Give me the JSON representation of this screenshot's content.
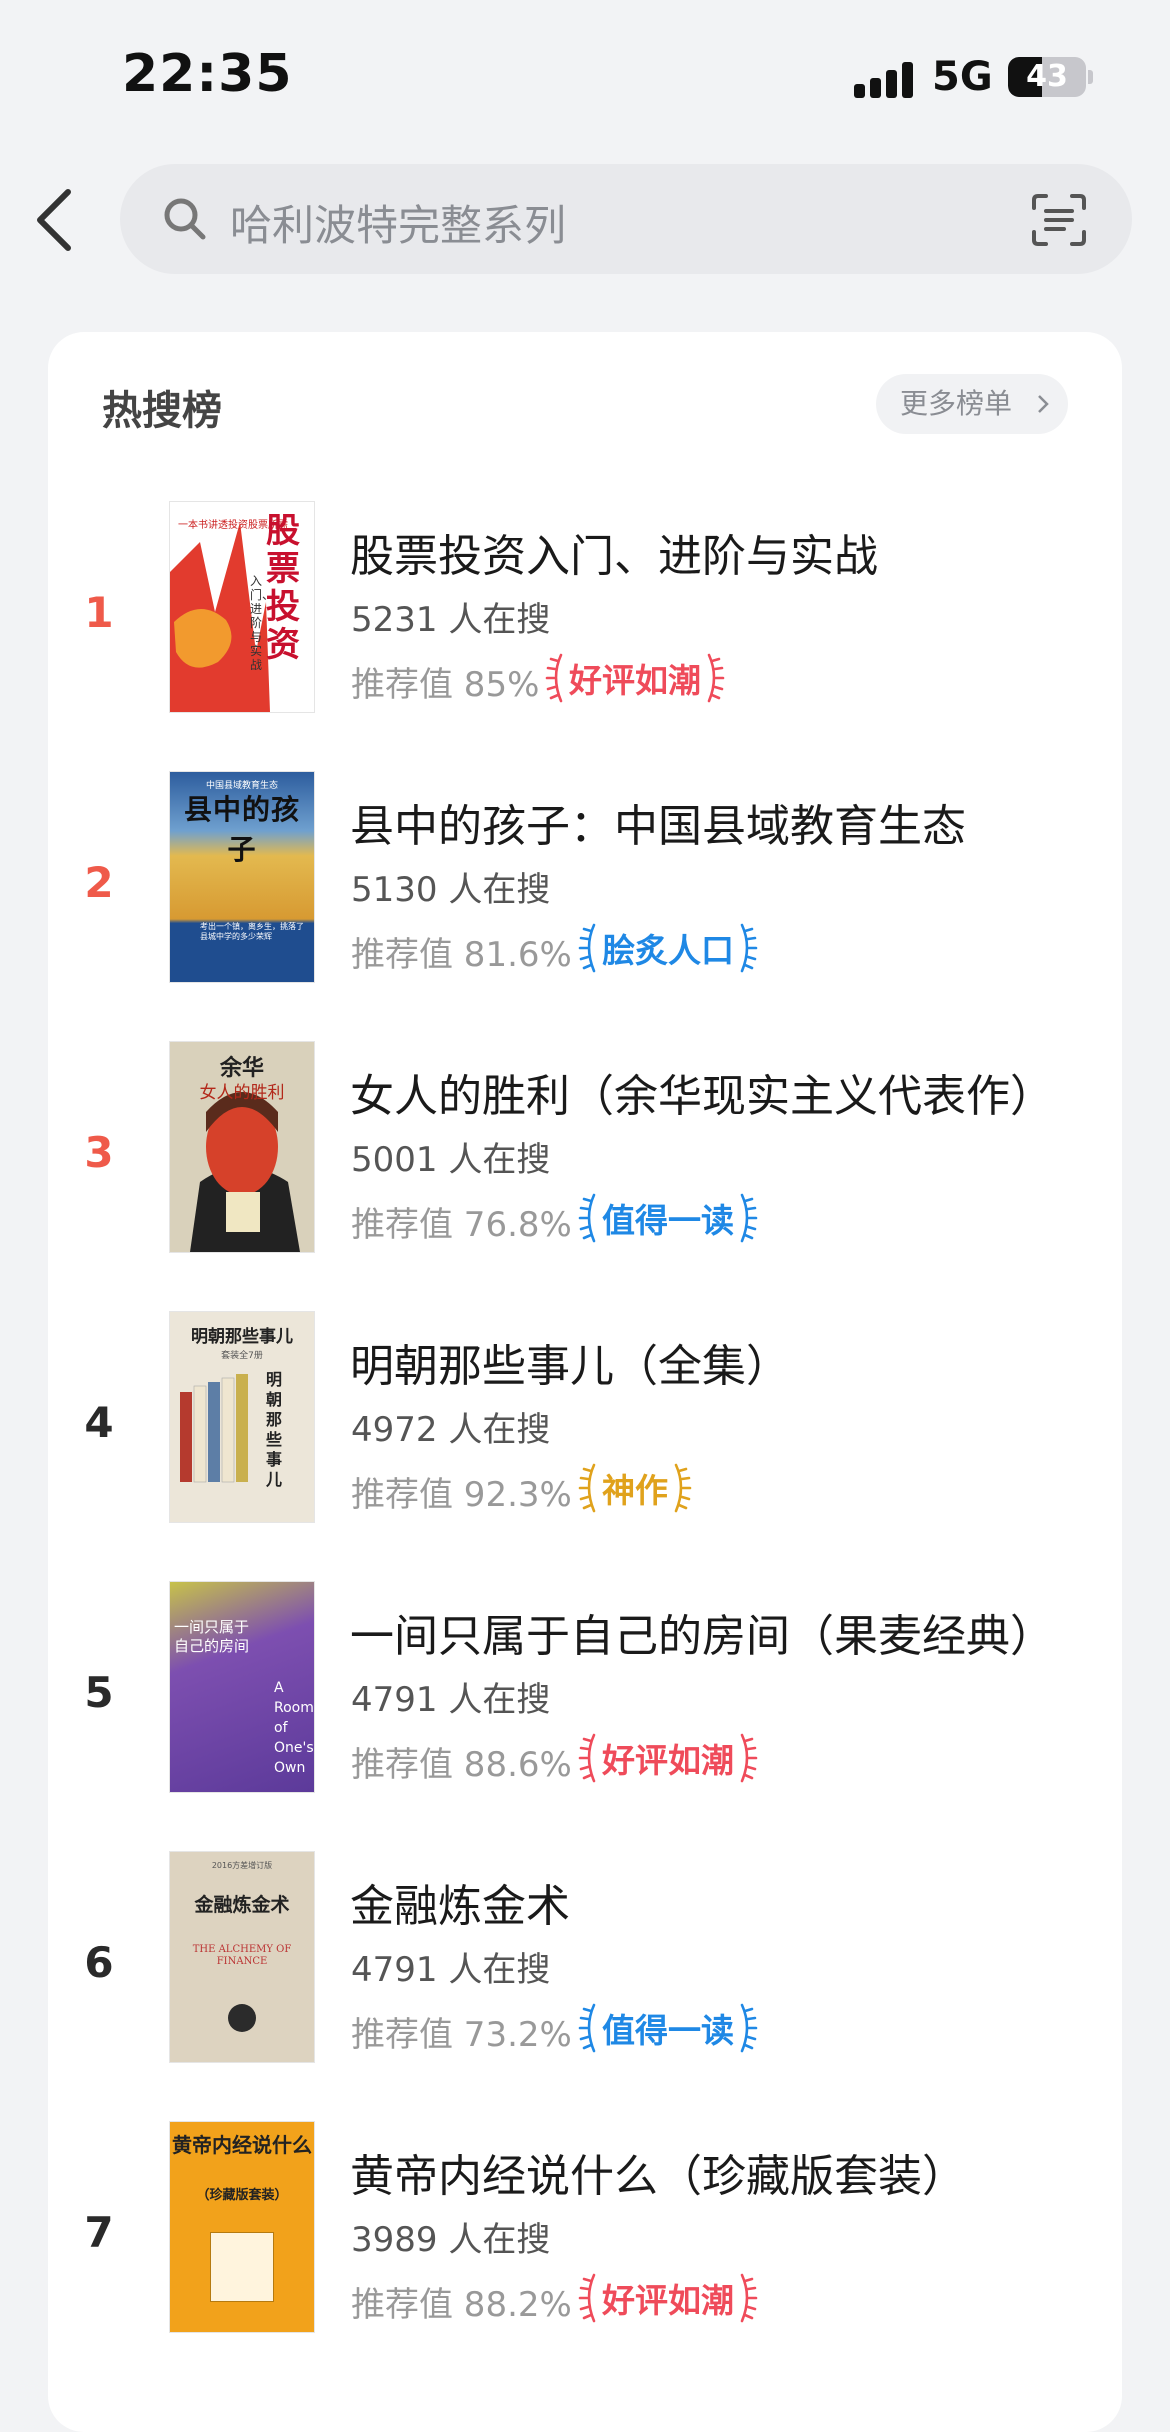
{
  "status": {
    "time": "22:35",
    "network": "5G",
    "battery": "43",
    "battery_level": 0.43
  },
  "search": {
    "placeholder": "哈利波特完整系列"
  },
  "hot": {
    "title": "热搜榜",
    "more_label": "更多榜单",
    "items": [
      {
        "rank": "1",
        "title": "股票投资入门、进阶与实战",
        "count": "5231 人在搜",
        "rec": "推荐值 85%",
        "badge": "好评如潮",
        "badge_color": "#ef4b5a",
        "cover": {
          "big": "股票投资",
          "sub": "入门、进阶与实战",
          "caption": "一本书讲透投资股票所需"
        }
      },
      {
        "rank": "2",
        "title": "县中的孩子：中国县域教育生态",
        "count": "5130 人在搜",
        "rec": "推荐值 81.6%",
        "badge": "脍炙人口",
        "badge_color": "#1f88e5",
        "cover": {
          "top": "中国县域教育生态",
          "big": "县中的孩子",
          "caption": "考出一个镇，离乡生，挑落了县城中学的多少荣辉"
        }
      },
      {
        "rank": "3",
        "title": "女人的胜利（余华现实主义代表作）",
        "count": "5001 人在搜",
        "rec": "推荐值 76.8%",
        "badge": "值得一读",
        "badge_color": "#1f88e5",
        "cover": {
          "author": "余华",
          "big": "女人的胜利"
        }
      },
      {
        "rank": "4",
        "title": "明朝那些事儿（全集）",
        "count": "4972 人在搜",
        "rec": "推荐值 92.3%",
        "badge": "神作",
        "badge_color": "#e0a21c",
        "cover": {
          "big": "明朝那些事儿",
          "sub": "套装全7册",
          "side": "明朝那些事儿"
        }
      },
      {
        "rank": "5",
        "title": "一间只属于自己的房间（果麦经典）",
        "count": "4791 人在搜",
        "rec": "推荐值 88.6%",
        "badge": "好评如潮",
        "badge_color": "#ef4b5a",
        "cover": {
          "big": "一间只属于自己的房间",
          "en": "A Room of One's Own"
        }
      },
      {
        "rank": "6",
        "title": "金融炼金术",
        "count": "4791 人在搜",
        "rec": "推荐值 73.2%",
        "badge": "值得一读",
        "badge_color": "#1f88e5",
        "cover": {
          "top": "2016方差增订版",
          "big": "金融炼金术",
          "en": "THE ALCHEMY OF FINANCE"
        }
      },
      {
        "rank": "7",
        "title": "黄帝内经说什么（珍藏版套装）",
        "count": "3989 人在搜",
        "rec": "推荐值 88.2%",
        "badge": "好评如潮",
        "badge_color": "#ef4b5a",
        "cover": {
          "big": "黄帝内经说什么",
          "sub": "（珍藏版套装）"
        }
      }
    ]
  }
}
